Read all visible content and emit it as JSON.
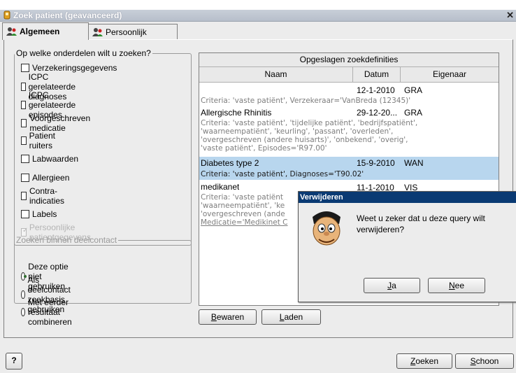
{
  "window": {
    "title": "Zoek patient (geavanceerd)",
    "close_glyph": "✕"
  },
  "tabs": [
    {
      "label": "Algemeen",
      "icon": "people-icon",
      "active": true
    },
    {
      "label": "Persoonlijk",
      "icon": "people-icon",
      "active": false
    }
  ],
  "search_parts": {
    "legend": "Op welke onderdelen wilt u zoeken?",
    "items": [
      {
        "label": "Verzekeringsgegevens",
        "checked": false,
        "disabled": false
      },
      {
        "label": "ICPC gerelateerde diagnoses",
        "checked": false,
        "disabled": false
      },
      {
        "label": "ICPC gerelateerde episodes",
        "checked": false,
        "disabled": false
      },
      {
        "label": "Voorgeschreven medicatie",
        "checked": false,
        "disabled": false
      },
      {
        "label": "Patient ruiters",
        "checked": false,
        "disabled": false
      },
      {
        "label": "Labwaarden",
        "checked": false,
        "disabled": false
      },
      {
        "label": "Allergieen",
        "checked": false,
        "disabled": false
      },
      {
        "label": "Contra-indicaties",
        "checked": false,
        "disabled": false
      },
      {
        "label": "Labels",
        "checked": false,
        "disabled": false
      },
      {
        "label": "Persoonlijke patientgegevens",
        "checked": true,
        "disabled": true
      }
    ]
  },
  "deelcontact": {
    "legend": "Zoeken binnen deelcontact",
    "options": [
      {
        "label": "Deze optie niet gebruiken",
        "selected": true
      },
      {
        "label": "Als deelcontact zoekbasis  gebruiken",
        "selected": false
      },
      {
        "label": "Met eerder resultaat combineren",
        "selected": false
      }
    ]
  },
  "saved_searches": {
    "title": "Opgeslagen zoekdefinities",
    "columns": [
      "Naam",
      "Datum",
      "Eigenaar"
    ],
    "rows": [
      {
        "naam": "",
        "datum": "12-1-2010",
        "eigenaar": "GRA",
        "criteria": [
          "Criteria: 'vaste patiënt', Verzekeraar='VanBreda (12345)'"
        ],
        "selected": false
      },
      {
        "naam": "Allergische Rhinitis",
        "datum": "29-12-20...",
        "eigenaar": "GRA",
        "criteria": [
          "Criteria: 'vaste patiënt', 'tijdelijke patiënt', 'bedrijfspatiënt',",
          "'waarneempatiënt', 'keurling', 'passant', 'overleden',",
          "'overgeschreven (andere huisarts)', 'onbekend', 'overig',",
          "'vaste patiënt', Episodes='R97.00'"
        ],
        "selected": false
      },
      {
        "naam": "Diabetes type 2",
        "datum": "15-9-2010",
        "eigenaar": "WAN",
        "criteria": [
          "Criteria: 'vaste patiënt', Diagnoses='T90.02'"
        ],
        "selected": true
      },
      {
        "naam": "medikanet",
        "datum": "11-1-2010",
        "eigenaar": "VIS",
        "criteria": [
          "Criteria: 'vaste patiënt",
          "'waarneempatiënt', 'ke",
          "'overgeschreven (ande",
          "Medicatie='Medikinet C"
        ],
        "selected": false
      }
    ]
  },
  "buttons": {
    "bewaren": {
      "accel": "B",
      "rest": "ewaren"
    },
    "laden": {
      "accel": "L",
      "rest": "aden"
    },
    "zoeken": {
      "accel": "Z",
      "rest": "oeken"
    },
    "schoon": {
      "accel": "S",
      "rest": "choon"
    },
    "help_glyph": "?"
  },
  "dialog": {
    "title": "Verwijderen",
    "message": "Weet u zeker dat u deze query wilt verwijderen?",
    "icon": "cartoon-face-icon",
    "ja": {
      "accel": "J",
      "rest": "a"
    },
    "nee": {
      "accel": "N",
      "rest": "ee"
    }
  },
  "colors": {
    "title_bar": "#b7bfcb",
    "dialog_title": "#0a3a73",
    "selected_row": "#b8d6ee"
  }
}
